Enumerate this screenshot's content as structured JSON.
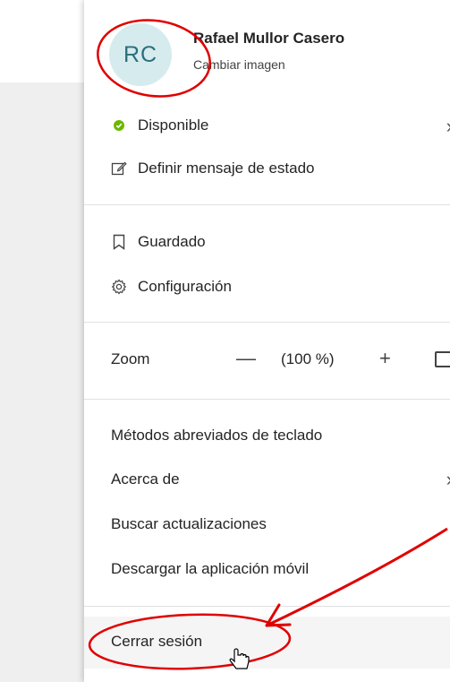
{
  "profile": {
    "initials": "RC",
    "name": "Rafael Mullor Casero",
    "change_image": "Cambiar imagen"
  },
  "status": {
    "available": "Disponible",
    "set_status_message": "Definir mensaje de estado"
  },
  "menu": {
    "saved": "Guardado",
    "settings": "Configuración",
    "zoom_label": "Zoom",
    "zoom_minus": "—",
    "zoom_value": "(100 %)",
    "zoom_plus": "+",
    "keyboard_shortcuts": "Métodos abreviados de teclado",
    "about": "Acerca de",
    "check_updates": "Buscar actualizaciones",
    "download_mobile": "Descargar la aplicación móvil",
    "sign_out": "Cerrar sesión"
  },
  "colors": {
    "available_dot": "#6bb700",
    "annotation_red": "#e00000"
  }
}
